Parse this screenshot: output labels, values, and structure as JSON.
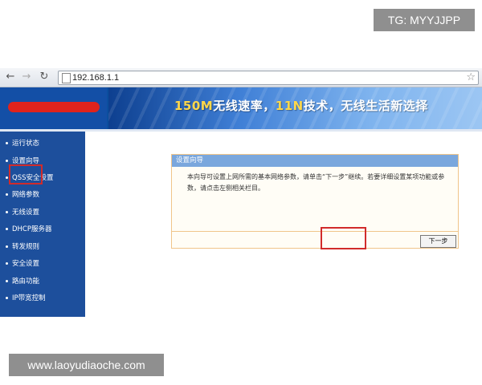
{
  "watermarks": {
    "top": "TG: MYYJJPP",
    "bottom": "www.laoyudiaoche.com"
  },
  "browser": {
    "url": "192.168.1.1",
    "back_icon": "back-arrow-icon",
    "forward_icon": "forward-arrow-icon",
    "reload_icon": "reload-icon",
    "bookmark_icon": "star-icon"
  },
  "banner": {
    "slogan_prefix": "150M",
    "slogan_part1": "无线速率，",
    "slogan_mid": "11N",
    "slogan_part2": "技术，无线生活新选择"
  },
  "sidebar": {
    "items": [
      {
        "label": "运行状态"
      },
      {
        "label": "设置向导"
      },
      {
        "label": "QSS安全设置"
      },
      {
        "label": "网络参数"
      },
      {
        "label": "无线设置"
      },
      {
        "label": "DHCP服务器"
      },
      {
        "label": "转发规则"
      },
      {
        "label": "安全设置"
      },
      {
        "label": "路由功能"
      },
      {
        "label": "IP带宽控制"
      }
    ],
    "selected": "设置向导"
  },
  "panel": {
    "title": "设置向导",
    "text": "本向导可设置上网所需的基本网络参数，请单击“下一步”继续。若要详细设置某项功能或参数，请点击左侧相关栏目。",
    "next_button": "下一步"
  },
  "colors": {
    "sidebar_bg": "#1d4f9c",
    "panel_border": "#f0c58a",
    "panel_title_bg": "#7aa7dd",
    "highlight_red": "#d12b2b"
  }
}
